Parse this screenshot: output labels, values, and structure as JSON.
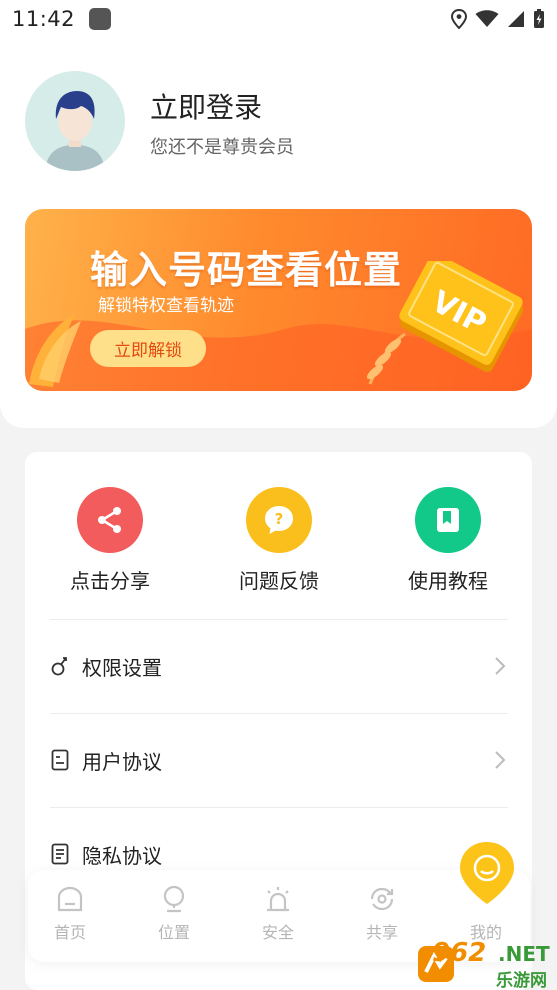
{
  "status_bar": {
    "time": "11:42"
  },
  "profile": {
    "login_title": "立即登录",
    "login_subtitle": "您还不是尊贵会员"
  },
  "banner": {
    "title": "输入号码查看位置",
    "subtitle": "解锁特权查看轨迹",
    "button_label": "立即解锁",
    "badge_text": "VIP"
  },
  "quick_actions": [
    {
      "label": "点击分享",
      "icon": "share-icon",
      "color": "#f25c5c"
    },
    {
      "label": "问题反馈",
      "icon": "question-icon",
      "color": "#fbbf1d"
    },
    {
      "label": "使用教程",
      "icon": "book-icon",
      "color": "#12c98a"
    }
  ],
  "menu_items": [
    {
      "label": "权限设置",
      "icon": "permission-icon"
    },
    {
      "label": "用户协议",
      "icon": "user-agreement-icon"
    },
    {
      "label": "隐私协议",
      "icon": "privacy-agreement-icon"
    }
  ],
  "tabs": [
    {
      "label": "首页",
      "icon": "home-icon"
    },
    {
      "label": "位置",
      "icon": "location-icon"
    },
    {
      "label": "安全",
      "icon": "alarm-icon"
    },
    {
      "label": "共享",
      "icon": "share-sync-icon"
    },
    {
      "label": "我的",
      "icon": "profile-icon"
    }
  ],
  "watermark": {
    "number": "962",
    "suffix": ".NET",
    "site": "乐游网"
  }
}
